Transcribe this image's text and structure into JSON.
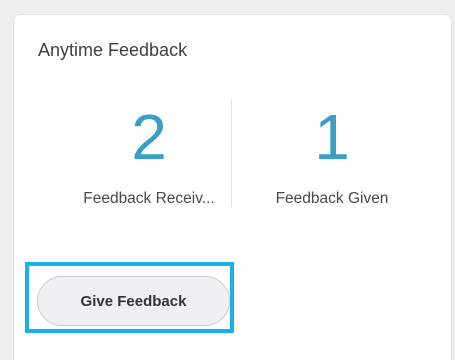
{
  "widget": {
    "title": "Anytime Feedback",
    "metrics": [
      {
        "value": "2",
        "label": "Feedback Receiv..."
      },
      {
        "value": "1",
        "label": "Feedback Given"
      }
    ],
    "action_label": "Give Feedback"
  },
  "colors": {
    "metric_value": "#3a9fc4",
    "highlight": "#16b4e6",
    "background": "#eeeeef",
    "card": "#ffffff"
  }
}
